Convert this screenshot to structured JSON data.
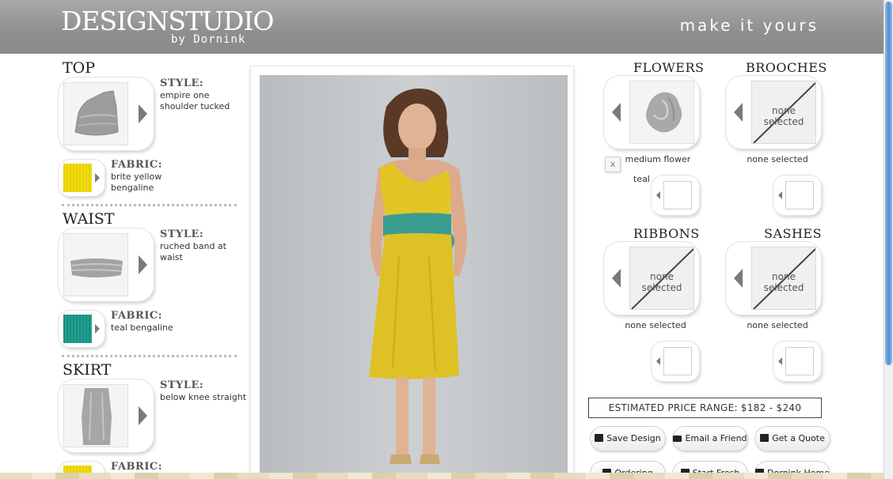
{
  "header": {
    "logo_main": "DESIGNSTUDIO",
    "logo_sub": "by Dornink",
    "tagline": "make it yours"
  },
  "left": {
    "top": {
      "title": "TOP",
      "style_label": "STYLE:",
      "style_value": "empire one shoulder tucked",
      "fabric_label": "FABRIC:",
      "fabric_value": "brite yellow bengaline"
    },
    "waist": {
      "title": "WAIST",
      "style_label": "STYLE:",
      "style_value": "ruched band at waist",
      "fabric_label": "FABRIC:",
      "fabric_value": "teal bengaline"
    },
    "skirt": {
      "title": "SKIRT",
      "style_label": "STYLE:",
      "style_value": "below knee straight",
      "fabric_label": "FABRIC:"
    }
  },
  "right": {
    "flowers": {
      "title": "FLOWERS",
      "caption": "medium flower",
      "color_label": "teal",
      "remove": "x"
    },
    "brooches": {
      "title": "BROOCHES",
      "none": "none selected",
      "caption": "none selected"
    },
    "ribbons": {
      "title": "RIBBONS",
      "none": "none selected",
      "caption": "none selected"
    },
    "sashes": {
      "title": "SASHES",
      "none": "none selected",
      "caption": "none selected"
    }
  },
  "price": {
    "text": "ESTIMATED PRICE RANGE: $182 - $240"
  },
  "buttons": {
    "save": "Save Design",
    "email": "Email a Friend",
    "quote": "Get a Quote",
    "ordering": "Ordering",
    "start": "Start Fresh",
    "home": "Dornink Home"
  },
  "colors": {
    "header_gray": "#969696",
    "dress_yellow": "#e2c626",
    "sash_teal": "#3a9c91"
  }
}
